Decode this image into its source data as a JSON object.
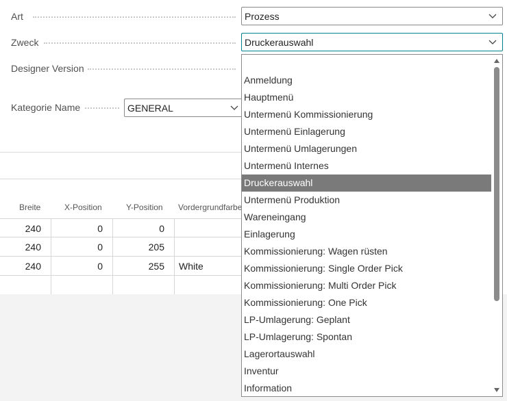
{
  "fields": {
    "art": {
      "label": "Art",
      "value": "Prozess"
    },
    "zweck": {
      "label": "Zweck",
      "value": "Druckerauswahl"
    },
    "designer_version": {
      "label": "Designer Version"
    },
    "kategorie": {
      "label": "Kategorie Name",
      "value": "GENERAL"
    }
  },
  "grid": {
    "columns": [
      "Breite",
      "X-Position",
      "Y-Position",
      "Vordergrundfarbe"
    ],
    "rows": [
      [
        "240",
        "0",
        "0",
        ""
      ],
      [
        "240",
        "0",
        "205",
        ""
      ],
      [
        "240",
        "0",
        "255",
        "White"
      ],
      [
        "",
        "",
        "",
        ""
      ]
    ]
  },
  "dropdown": {
    "selected": "Druckerauswahl",
    "items": [
      "",
      "Anmeldung",
      "Hauptmenü",
      "Untermenü Kommissionierung",
      "Untermenü Einlagerung",
      "Untermenü Umlagerungen",
      "Untermenü Internes",
      "Druckerauswahl",
      "Untermenü Produktion",
      "Wareneingang",
      "Einlagerung",
      "Kommissionierung: Wagen rüsten",
      "Kommissionierung: Single Order Pick",
      "Kommissionierung: Multi Order Pick",
      "Kommissionierung: One Pick",
      "LP-Umlagerung: Geplant",
      "LP-Umlagerung: Spontan",
      "Lagerortauswahl",
      "Inventur",
      "Information"
    ]
  },
  "icons": {
    "dropdown_arrow": "chevron-down-icon",
    "scroll_up": "scroll-up-arrow-icon",
    "scroll_down": "scroll-down-arrow-icon"
  },
  "colors": {
    "focus_border": "#00828c",
    "selected_item": "#7a7a7a",
    "footer_bg": "#f3f3f3"
  }
}
